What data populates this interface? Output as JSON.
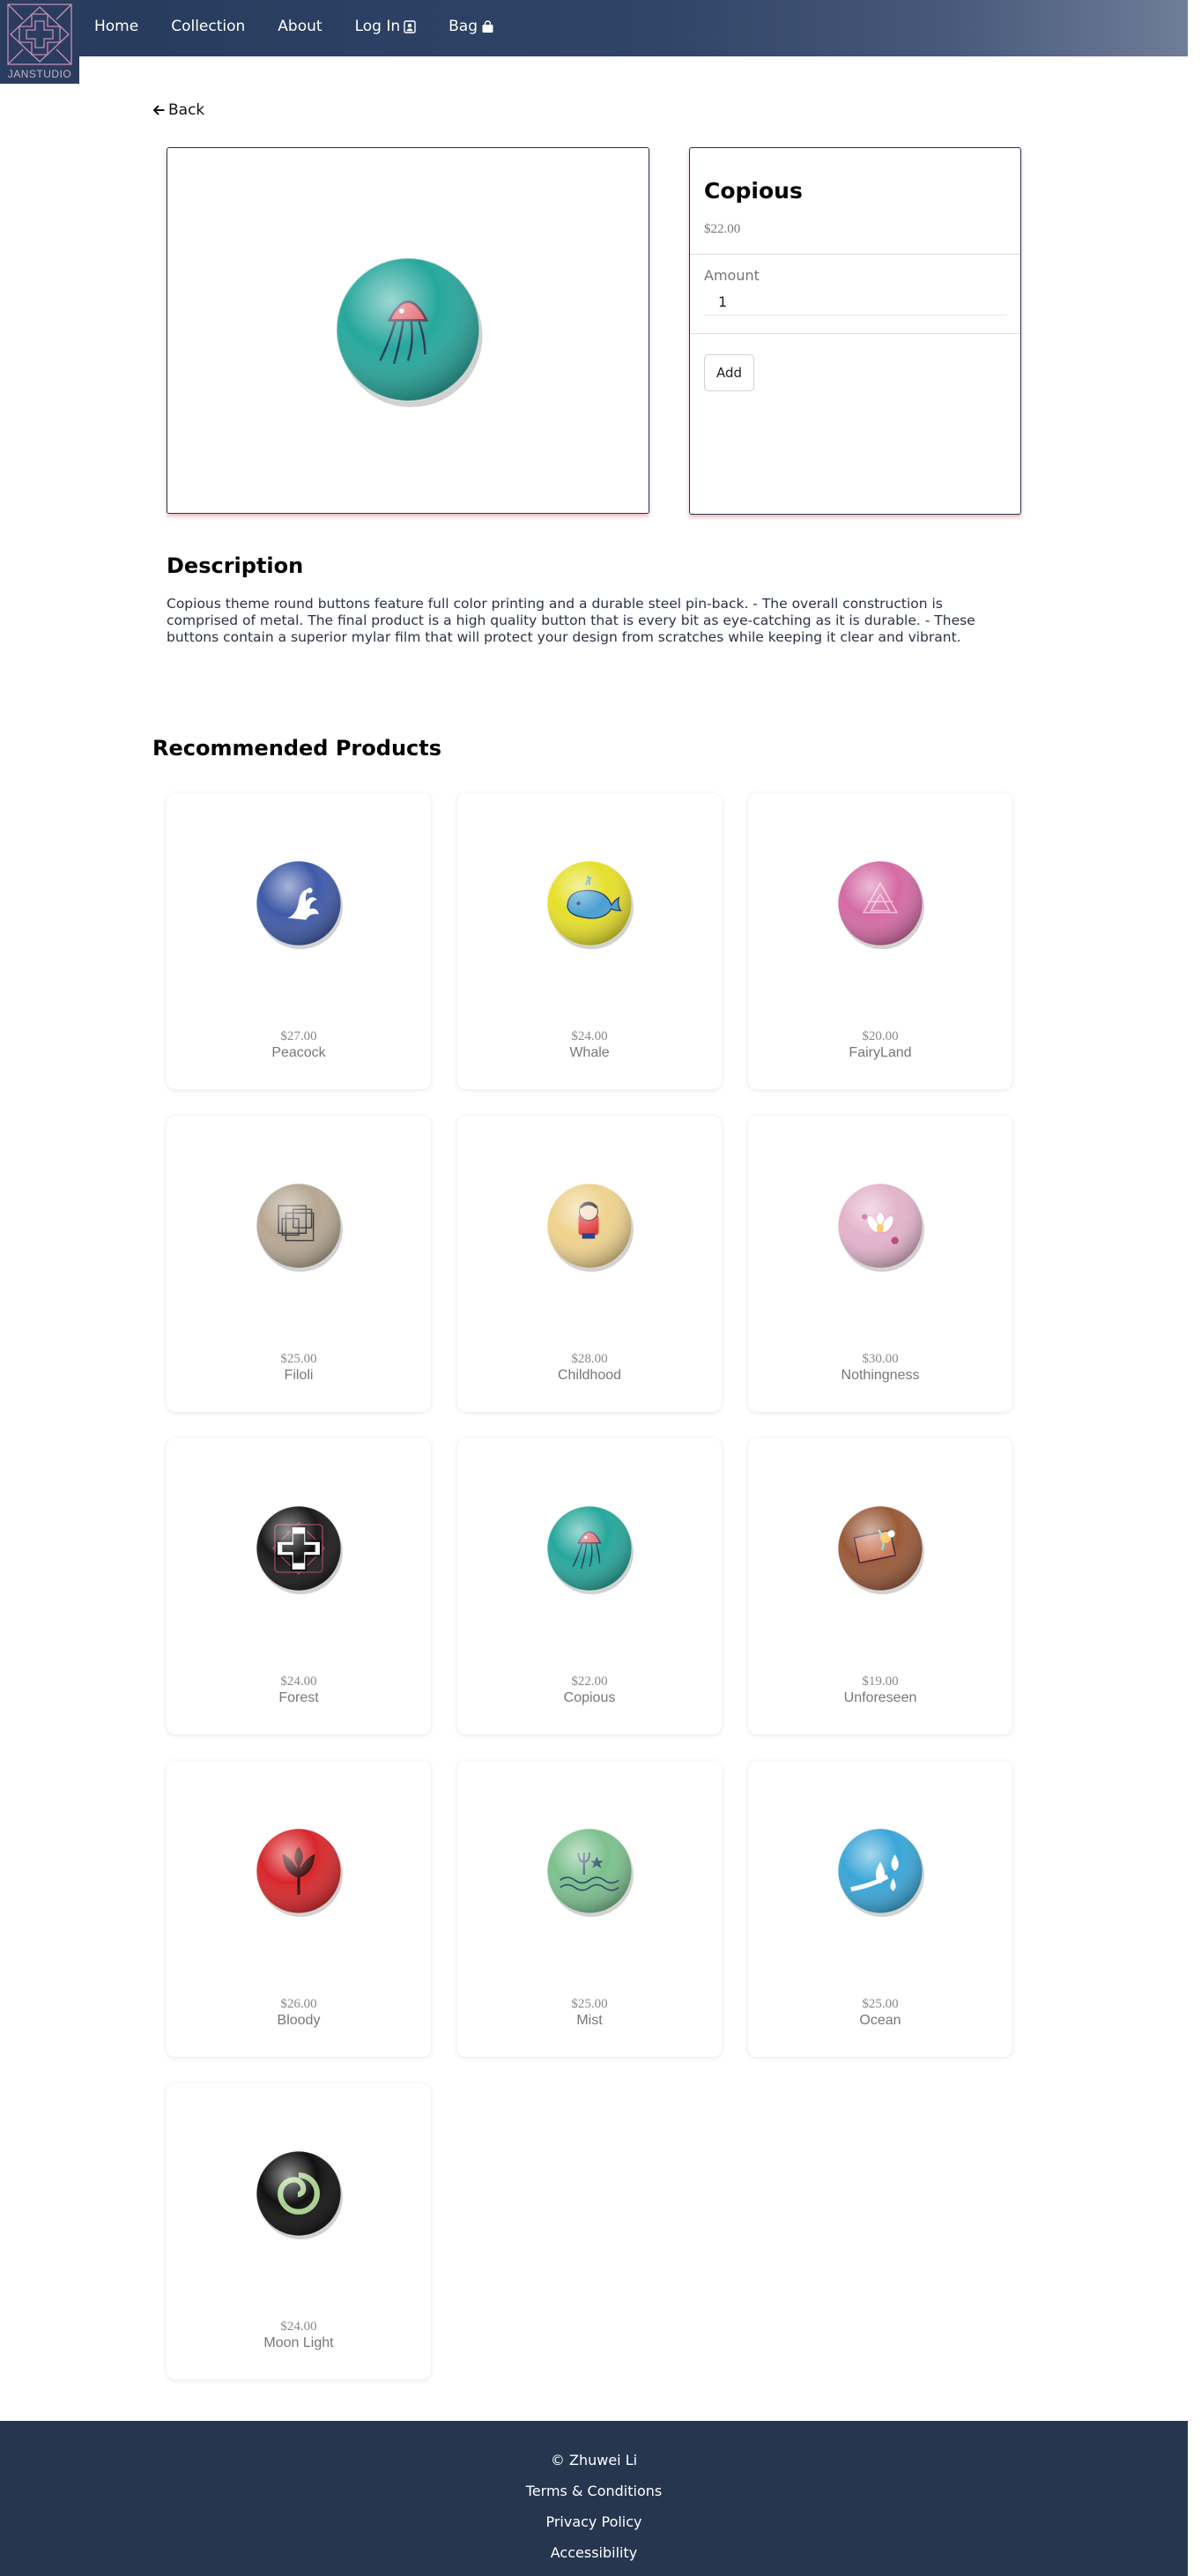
{
  "brand": {
    "logo_text": "JANSTUDIO"
  },
  "nav": {
    "items": [
      {
        "label": "Home"
      },
      {
        "label": "Collection"
      },
      {
        "label": "About"
      },
      {
        "label": "Log In",
        "icon": "user-icon"
      },
      {
        "label": "Bag",
        "icon": "bag-icon"
      }
    ]
  },
  "back_label": "Back",
  "product": {
    "name": "Copious",
    "price": "$22.00",
    "amount_label": "Amount",
    "amount_value": "1",
    "add_label": "Add"
  },
  "description": {
    "title": "Description",
    "text": "Copious theme round buttons feature full color printing and a durable steel pin-back. - The overall construction is comprised of metal. The final product is a high quality button that is every bit as eye-catching as it is durable. - These buttons contain a superior mylar film that will protect your design from scratches while keeping it clear and vibrant."
  },
  "recommended": {
    "title": "Recommended Products",
    "items": [
      {
        "name": "Peacock",
        "price": "$27.00",
        "color": "#3f5aa8",
        "art": "peacock"
      },
      {
        "name": "Whale",
        "price": "$24.00",
        "color": "#e6df2a",
        "art": "whale"
      },
      {
        "name": "FairyLand",
        "price": "$20.00",
        "color": "#d46aa4",
        "art": "triangles"
      },
      {
        "name": "Filoli",
        "price": "$25.00",
        "color": "#b6a793",
        "art": "squares"
      },
      {
        "name": "Childhood",
        "price": "$28.00",
        "color": "#efd28e",
        "art": "cartoon"
      },
      {
        "name": "Nothingness",
        "price": "$30.00",
        "color": "#e3b3cc",
        "art": "flower"
      },
      {
        "name": "Forest",
        "price": "$24.00",
        "color": "#1a1a1a",
        "art": "pattern"
      },
      {
        "name": "Copious",
        "price": "$22.00",
        "color": "#27a79c",
        "art": "jellyfish"
      },
      {
        "name": "Unforeseen",
        "price": "$19.00",
        "color": "#9a5a3a",
        "art": "unforeseen"
      },
      {
        "name": "Bloody",
        "price": "$26.00",
        "color": "#d8282c",
        "art": "plant"
      },
      {
        "name": "Mist",
        "price": "$25.00",
        "color": "#7cc08e",
        "art": "trident"
      },
      {
        "name": "Ocean",
        "price": "$25.00",
        "color": "#3aa6d8",
        "art": "drops"
      },
      {
        "name": "Moon Light",
        "price": "$24.00",
        "color": "#111111",
        "art": "swirl"
      }
    ]
  },
  "footer": {
    "copyright": "© Zhuwei Li",
    "links": [
      "Terms & Conditions",
      "Privacy Policy",
      "Accessibility"
    ]
  }
}
